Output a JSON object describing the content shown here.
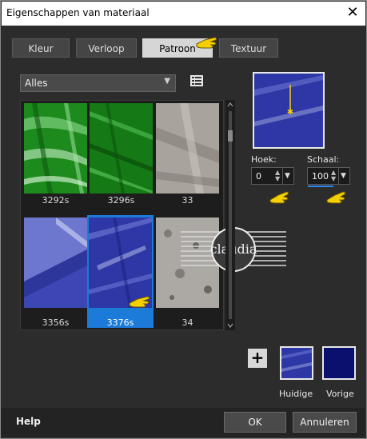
{
  "window": {
    "title": "Eigenschappen van materiaal"
  },
  "tabs": [
    {
      "label": "Kleur",
      "active": false
    },
    {
      "label": "Verloop",
      "active": false
    },
    {
      "label": "Patroon",
      "active": true
    },
    {
      "label": "Textuur",
      "active": false
    }
  ],
  "category": {
    "value": "Alles"
  },
  "patterns": [
    {
      "name": "3292s",
      "selected": false
    },
    {
      "name": "3296s",
      "selected": false
    },
    {
      "name": "33",
      "selected": false
    },
    {
      "name": "3356s",
      "selected": false
    },
    {
      "name": "3376s",
      "selected": true
    },
    {
      "name": "34",
      "selected": false
    }
  ],
  "angle": {
    "label": "Hoek:",
    "value": "0"
  },
  "scale": {
    "label": "Schaal:",
    "value": "100"
  },
  "swatches": {
    "current_label": "Huidige",
    "previous_label": "Vorige",
    "previous_color": "#0a106e"
  },
  "footer": {
    "help": "Help",
    "ok": "OK",
    "cancel": "Annuleren"
  },
  "watermark": {
    "text": "claudia"
  },
  "colors": {
    "accent": "#1c7ad8",
    "pointer": "#f5d000"
  }
}
